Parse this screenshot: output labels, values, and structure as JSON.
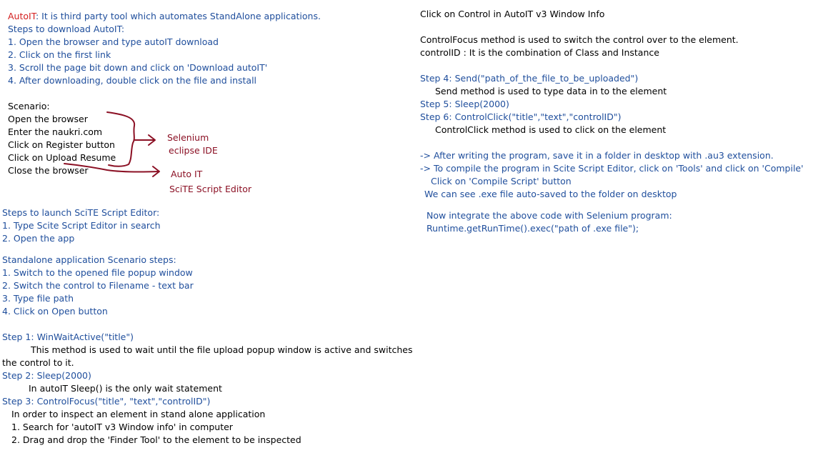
{
  "left": {
    "intro": {
      "term": "AutoIT",
      "definition": ": It is third party tool which automates StandAlone applications."
    },
    "download": {
      "heading": "Steps to download AutoIT:",
      "steps": [
        "1. Open the browser and type autoIT download",
        "2. Click on the first link",
        "3. Scroll the page bit down and click on 'Download autoIT'",
        "4. After downloading, double click on the file and install"
      ]
    },
    "scenario": {
      "heading": "Scenario:",
      "items": [
        "Open the browser",
        "Enter the naukri.com",
        "Click on Register button",
        "Click on Upload Resume",
        "Close the browser"
      ],
      "annotations": {
        "selenium_line1": "Selenium",
        "selenium_line2": "eclipse IDE",
        "autoit_line1": "Auto IT",
        "autoit_line2": "SciTE Script Editor"
      }
    },
    "launch": {
      "heading": "Steps to launch SciTE Script Editor:",
      "steps": [
        "1. Type Scite Script Editor in search",
        "2. Open the app"
      ]
    },
    "standalone": {
      "heading": "Standalone application Scenario steps:",
      "steps": [
        "1. Switch to the opened file popup window",
        "2. Switch the control to Filename - text bar",
        "3. Type file path",
        "4. Click on Open button"
      ]
    },
    "code_steps": {
      "step1": "Step 1: WinWaitActive(\"title\")",
      "step1_desc_a": "This method is used to wait until the file upload popup window is active and switches",
      "step1_desc_b": "the control to it.",
      "step2": "Step 2: Sleep(2000)",
      "step2_desc": "In autoIT Sleep() is the only wait statement",
      "step3": "Step 3: ControlFocus(\"title\", \"text\",\"controlID\")",
      "step3_desc": "In order to inspect an element in stand alone application",
      "inspect_1": "1. Search for 'autoIT v3 Window info' in computer",
      "inspect_2": "2. Drag and drop the 'Finder Tool' to the element to be inspected"
    }
  },
  "right": {
    "line1": "Click on Control in AutoIT v3 Window Info",
    "focus_desc": "ControlFocus method is used to switch the control over to the element.",
    "controlid_desc": "controlID : It is the combination of Class and Instance",
    "step4": "Step 4: Send(\"path_of_the_file_to_be_uploaded\")",
    "step4_desc": "Send method is used to type data in to the element",
    "step5": "Step 5: Sleep(2000)",
    "step6": "Step 6: ControlClick(\"title\",\"text\",\"controlID\")",
    "step6_desc": "ControlClick method is used to click on the element",
    "after_1": "-> After writing the program, save it in a folder in desktop with .au3 extension.",
    "after_2": "-> To compile the program in Scite Script Editor, click on 'Tools' and click on 'Compile'",
    "after_3": "Click on 'Compile Script' button",
    "after_4": "We can see .exe file auto-saved to the folder on desktop",
    "integrate_1": "Now integrate the above code with Selenium program:",
    "integrate_2": "Runtime.getRunTime().exec(\"path of .exe file\");"
  },
  "colors": {
    "text": "#000000",
    "steps_blue": "#1f4e9c",
    "autoit_red": "#d42020",
    "annotation_maroon": "#8b1024"
  }
}
